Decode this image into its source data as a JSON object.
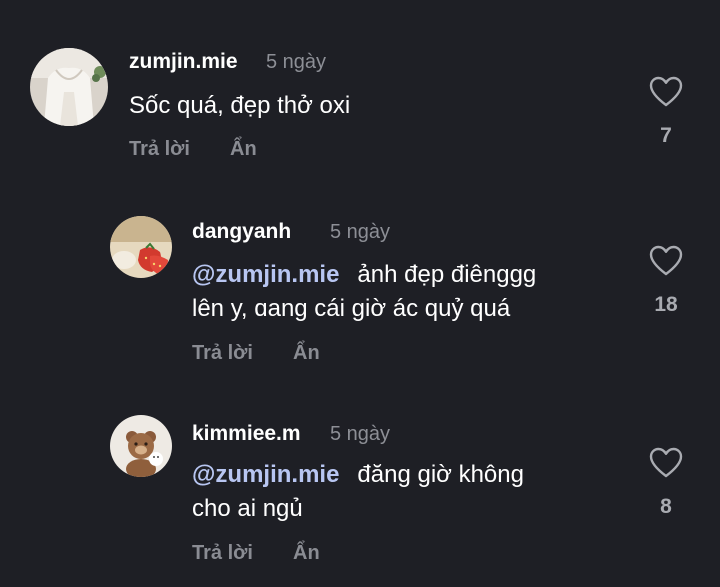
{
  "comments": [
    {
      "username": "zumjin.mie",
      "time": "5 ngày",
      "mention": "",
      "text_lines": [
        "Sốc quá, đẹp thở oxi"
      ],
      "reply_label": "Trả lời",
      "hide_label": "Ẩn",
      "likes": "7",
      "avatar_icon": "white-shirt-photo-avatar"
    },
    {
      "username": "dangyanh",
      "time": "5 ngày",
      "mention": "@zumjin.mie",
      "text_lines": [
        "ảnh đẹp điênggg",
        "lên y, ɑang cái giờ ác quỷ quá"
      ],
      "reply_label": "Trả lời",
      "hide_label": "Ẩn",
      "likes": "18",
      "avatar_icon": "strawberry-photo-avatar"
    },
    {
      "username": "kimmiee.m",
      "time": "5 ngày",
      "mention": "@zumjin.mie",
      "text_lines": [
        "đăng giờ không",
        "cho ai ngủ"
      ],
      "reply_label": "Trả lời",
      "hide_label": "Ẩn",
      "likes": "8",
      "avatar_icon": "teddy-bear-photo-avatar"
    }
  ],
  "colors": {
    "background": "#1e1f25",
    "username": "#ffffff",
    "timestamp": "#8d8f96",
    "mention": "#b8c6f2",
    "action": "#8a8c93",
    "like_count": "#a9abb1"
  }
}
